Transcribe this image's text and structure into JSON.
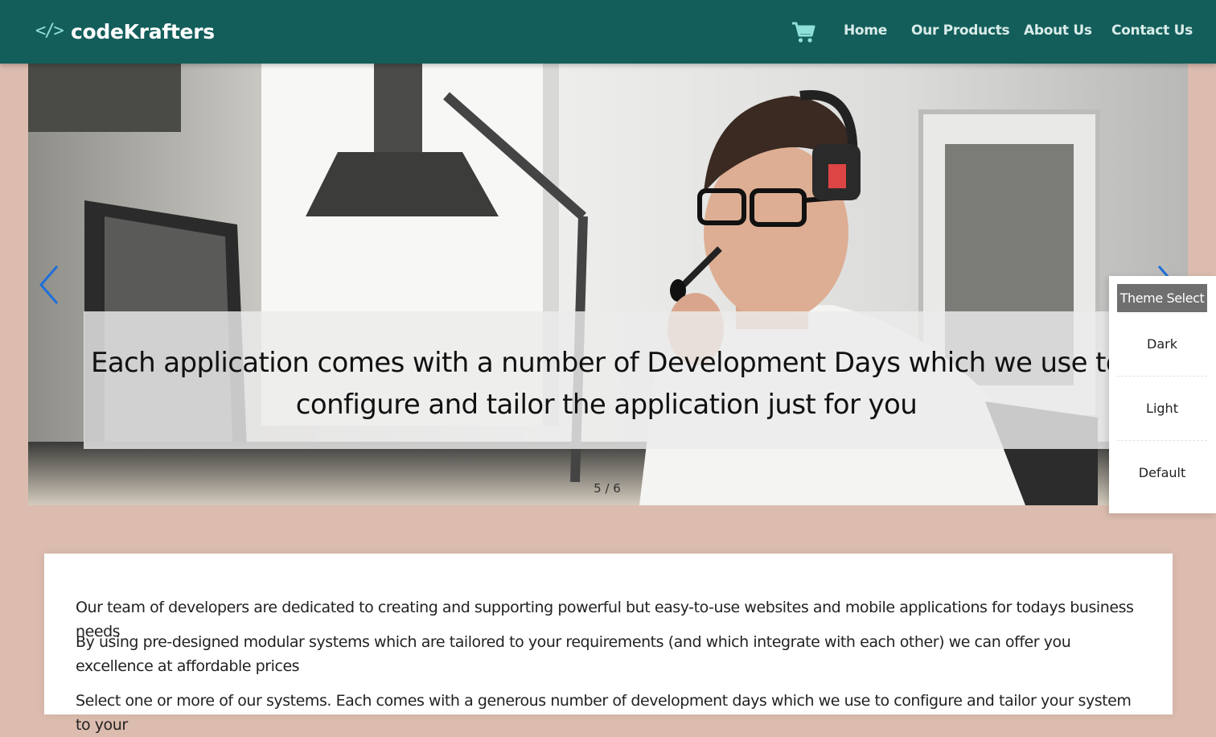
{
  "header": {
    "brand": "codeKrafters",
    "brand_icon": "code-brackets-icon",
    "cart_icon": "shopping-cart-icon",
    "nav": [
      "Home",
      "Our Products",
      "About Us",
      "Contact Us"
    ],
    "colors": {
      "bar": "#135e5b",
      "accent": "#8fe0d9"
    }
  },
  "hero": {
    "caption_line1": "Each application comes with a number of Development Days which we use to",
    "caption_line2": "configure and tailor the application just for you",
    "counter": "5 / 6",
    "prev_icon": "chevron-left-icon",
    "next_icon": "chevron-right-icon"
  },
  "theme": {
    "title": "Theme Select",
    "options": [
      "Dark",
      "Light",
      "Default"
    ]
  },
  "content": {
    "paragraphs": [
      "Our team of developers are dedicated to creating and supporting powerful but easy-to-use websites and mobile applications for todays business needs",
      "By using pre-designed modular systems which are tailored to your requirements (and which integrate with each other) we can offer you excellence at affordable prices",
      "Select one or more of our systems. Each comes with a generous number of development days which we use to configure and tailor your system to your"
    ]
  }
}
